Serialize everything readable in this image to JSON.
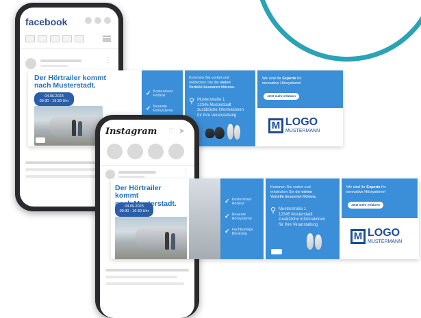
{
  "facebook": {
    "brand": "facebook"
  },
  "instagram": {
    "brand": "Instagram"
  },
  "ad": {
    "headline_line1": "Der Hörtrailer kommt",
    "headline_line2": "nach Musterstadt.",
    "date": "04.06.2023",
    "time": "09:30 - 16:30 Uhr",
    "features": [
      {
        "line1": "Kostenloser",
        "line2": "Hörtest"
      },
      {
        "line1": "Neueste",
        "line2": "Hörsysteme"
      },
      {
        "line1": "Fachkundige",
        "line2": "Beratung"
      }
    ],
    "promo_line1": "Kommen Sie vorbei und",
    "promo_line2_pre": "entdecken Sie die ",
    "promo_line2_bold": "vielen",
    "promo_line3_bold": "Vorteile besseren Hörens.",
    "address_line1": "Musterstraße 1",
    "address_line2": "12345 Musterstadt",
    "address_line3": "zusätzliche Informationen",
    "address_line4": "für Ihre Veranstaltung",
    "expert_pre": "Wir sind Ihr ",
    "expert_bold": "Experte",
    "expert_post": " für",
    "expert_line2": "innovative Hörsysteme!",
    "cta": "Jetzt mehr erfahren",
    "logo_letter": "M",
    "logo_word": "LOGO",
    "logo_sub": "MUSTERMANN"
  },
  "colors": {
    "accent_teal": "#2ba3b5",
    "panel_blue": "#3b8ed8",
    "headline_blue": "#1f6fbf",
    "logo_navy": "#1a4c95"
  }
}
